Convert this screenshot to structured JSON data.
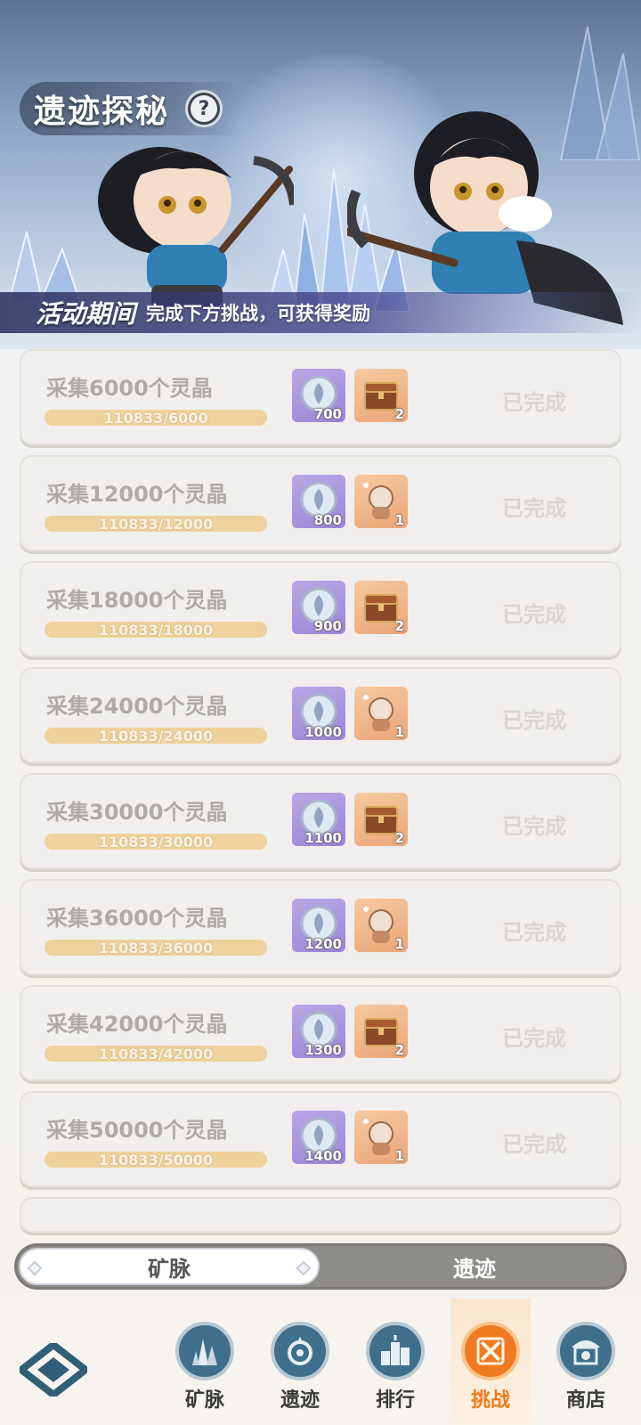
{
  "header": {
    "title": "遗迹探秘",
    "help_icon_glyph": "?",
    "period_label": "活动期间",
    "period_desc": "完成下方挑战，可获得奖励"
  },
  "tasks": [
    {
      "title": "采集6000个灵晶",
      "progress_text": "110833/6000",
      "progress": 1.0,
      "reward_crystal": "700",
      "reward_item_icon": "treasure-chest-icon",
      "reward_item": "2",
      "status": "已完成"
    },
    {
      "title": "采集12000个灵晶",
      "progress_text": "110833/12000",
      "progress": 1.0,
      "reward_crystal": "800",
      "reward_item_icon": "pet-doll-icon",
      "reward_item": "1",
      "status": "已完成"
    },
    {
      "title": "采集18000个灵晶",
      "progress_text": "110833/18000",
      "progress": 1.0,
      "reward_crystal": "900",
      "reward_item_icon": "treasure-chest-icon",
      "reward_item": "2",
      "status": "已完成"
    },
    {
      "title": "采集24000个灵晶",
      "progress_text": "110833/24000",
      "progress": 1.0,
      "reward_crystal": "1000",
      "reward_item_icon": "pet-doll-icon",
      "reward_item": "1",
      "status": "已完成"
    },
    {
      "title": "采集30000个灵晶",
      "progress_text": "110833/30000",
      "progress": 1.0,
      "reward_crystal": "1100",
      "reward_item_icon": "treasure-chest-icon",
      "reward_item": "2",
      "status": "已完成"
    },
    {
      "title": "采集36000个灵晶",
      "progress_text": "110833/36000",
      "progress": 1.0,
      "reward_crystal": "1200",
      "reward_item_icon": "pet-doll-icon",
      "reward_item": "1",
      "status": "已完成"
    },
    {
      "title": "采集42000个灵晶",
      "progress_text": "110833/42000",
      "progress": 1.0,
      "reward_crystal": "1300",
      "reward_item_icon": "treasure-chest-icon",
      "reward_item": "2",
      "status": "已完成"
    },
    {
      "title": "采集50000个灵晶",
      "progress_text": "110833/50000",
      "progress": 1.0,
      "reward_crystal": "1400",
      "reward_item_icon": "pet-doll-icon",
      "reward_item": "1",
      "status": "已完成"
    }
  ],
  "toggle": {
    "active_label": "矿脉",
    "inactive_label": "遗迹"
  },
  "nav": {
    "items": [
      {
        "label": "矿脉",
        "icon": "crystal-icon",
        "active": false
      },
      {
        "label": "遗迹",
        "icon": "ruins-icon",
        "active": false
      },
      {
        "label": "排行",
        "icon": "ranking-icon",
        "active": false
      },
      {
        "label": "挑战",
        "icon": "crossed-swords-icon",
        "active": true
      },
      {
        "label": "商店",
        "icon": "shop-icon",
        "active": false
      }
    ]
  },
  "colors": {
    "accent_active": "#f07a1a",
    "nav_icon_bg": "#3f6f8a",
    "card_bg": "#f0efed",
    "progress_bar": "#e9d3a8"
  }
}
